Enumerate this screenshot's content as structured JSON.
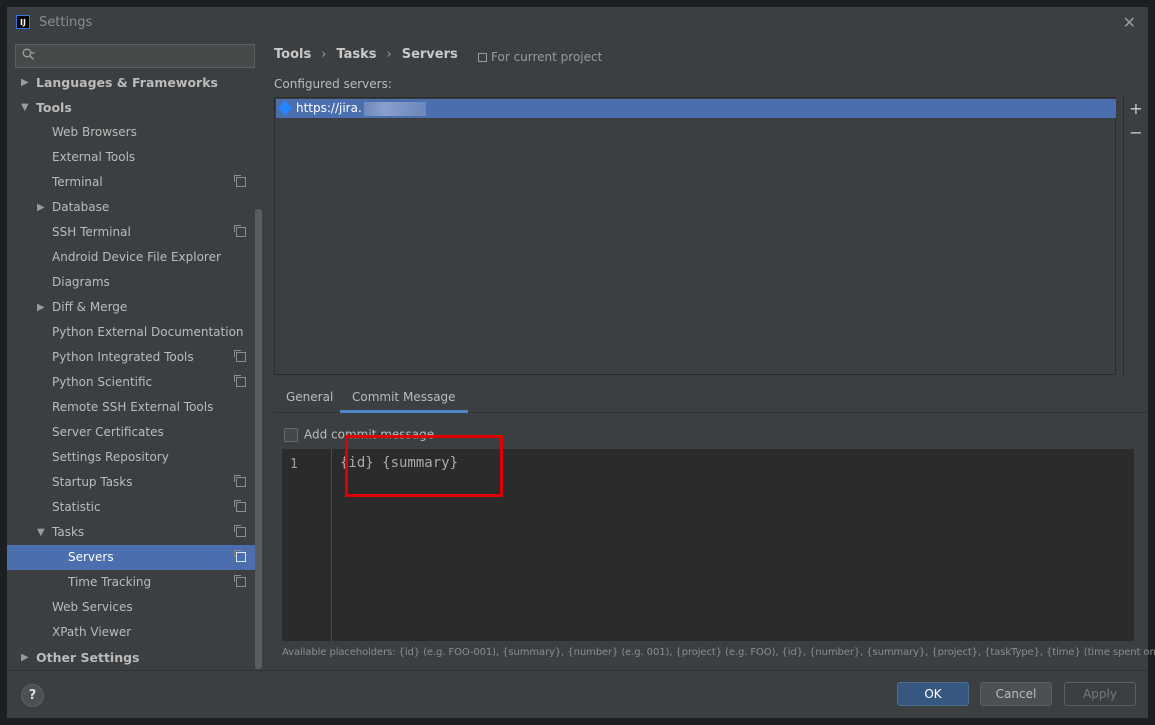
{
  "window": {
    "title": "Settings",
    "app_icon_text": "IJ",
    "close_label": "✕"
  },
  "sidebar": {
    "search_placeholder": "",
    "items": [
      {
        "label": "Languages & Frameworks",
        "level": 0,
        "arrow": "right",
        "bold": true
      },
      {
        "label": "Tools",
        "level": 0,
        "arrow": "down",
        "bold": true
      },
      {
        "label": "Web Browsers",
        "level": 1
      },
      {
        "label": "External Tools",
        "level": 1
      },
      {
        "label": "Terminal",
        "level": 1,
        "project_icon": true
      },
      {
        "label": "Database",
        "level": 1,
        "arrow": "right"
      },
      {
        "label": "SSH Terminal",
        "level": 1,
        "project_icon": true
      },
      {
        "label": "Android Device File Explorer",
        "level": 1
      },
      {
        "label": "Diagrams",
        "level": 1
      },
      {
        "label": "Diff & Merge",
        "level": 1,
        "arrow": "right"
      },
      {
        "label": "Python External Documentation",
        "level": 1
      },
      {
        "label": "Python Integrated Tools",
        "level": 1,
        "project_icon": true
      },
      {
        "label": "Python Scientific",
        "level": 1,
        "project_icon": true
      },
      {
        "label": "Remote SSH External Tools",
        "level": 1
      },
      {
        "label": "Server Certificates",
        "level": 1
      },
      {
        "label": "Settings Repository",
        "level": 1
      },
      {
        "label": "Startup Tasks",
        "level": 1,
        "project_icon": true
      },
      {
        "label": "Statistic",
        "level": 1,
        "project_icon": true
      },
      {
        "label": "Tasks",
        "level": 1,
        "arrow": "down",
        "project_icon": true
      },
      {
        "label": "Servers",
        "level": 2,
        "project_icon": true,
        "selected": true
      },
      {
        "label": "Time Tracking",
        "level": 2,
        "project_icon": true
      },
      {
        "label": "Web Services",
        "level": 1
      },
      {
        "label": "XPath Viewer",
        "level": 1
      },
      {
        "label": "Other Settings",
        "level": 0,
        "arrow": "right",
        "bold": true
      }
    ]
  },
  "breadcrumb": {
    "part1": "Tools",
    "part2": "Tasks",
    "part3": "Servers",
    "separator": "›"
  },
  "scope_label": "For current project",
  "configured_label": "Configured servers:",
  "servers": [
    {
      "url": "https://jira."
    }
  ],
  "list_tools": {
    "add": "+",
    "remove": "−"
  },
  "tabs": [
    {
      "label": "General",
      "active": false
    },
    {
      "label": "Commit Message",
      "active": true
    }
  ],
  "add_commit_message_label": "Add commit message",
  "add_commit_message_checked": false,
  "editor": {
    "line_number": "1",
    "content": "{id} {summary}"
  },
  "placeholders_text": "Available placeholders: {id} (e.g. FOO-001), {summary}, {number} (e.g. 001), {project} (e.g. FOO), {id}, {number}, {summary}, {project}, {taskType}, {time} (time spent on task)",
  "buttons": {
    "help": "?",
    "ok": "OK",
    "cancel": "Cancel",
    "apply": "Apply"
  },
  "colors": {
    "selection": "#4b6eaf",
    "ok_button": "#365880",
    "highlight_box": "#e00000",
    "tab_underline": "#4a88c7"
  }
}
